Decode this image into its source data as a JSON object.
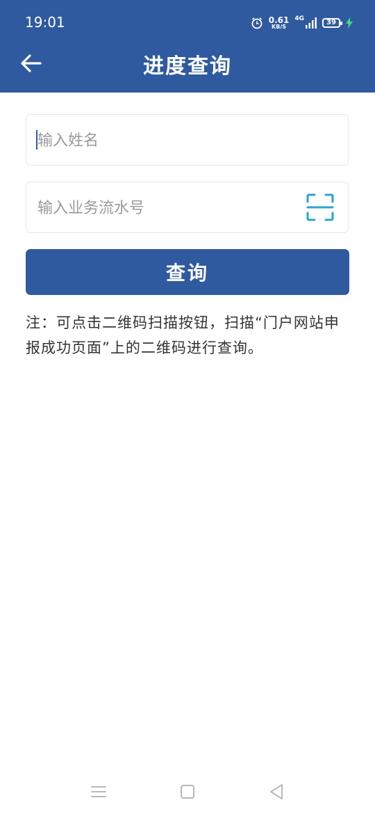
{
  "status_bar": {
    "time": "19:01",
    "net_speed_value": "0.61",
    "net_speed_unit": "KB/S",
    "signal_label": "4G",
    "battery": "39"
  },
  "header": {
    "title": "进度查询"
  },
  "form": {
    "name_placeholder": "输入姓名",
    "serial_placeholder": "输入业务流水号",
    "query_button": "查询"
  },
  "note": "注：可点击二维码扫描按钮，扫描“门户网站申报成功页面”上的二维码进行查询。",
  "colors": {
    "primary": "#2f5a9f",
    "scan_icon": "#29a3d6"
  },
  "icons": {
    "back": "arrow-left-icon",
    "scan": "qr-scan-icon",
    "nav_menu": "menu-icon",
    "nav_home": "home-square-icon",
    "nav_back": "back-triangle-icon"
  }
}
